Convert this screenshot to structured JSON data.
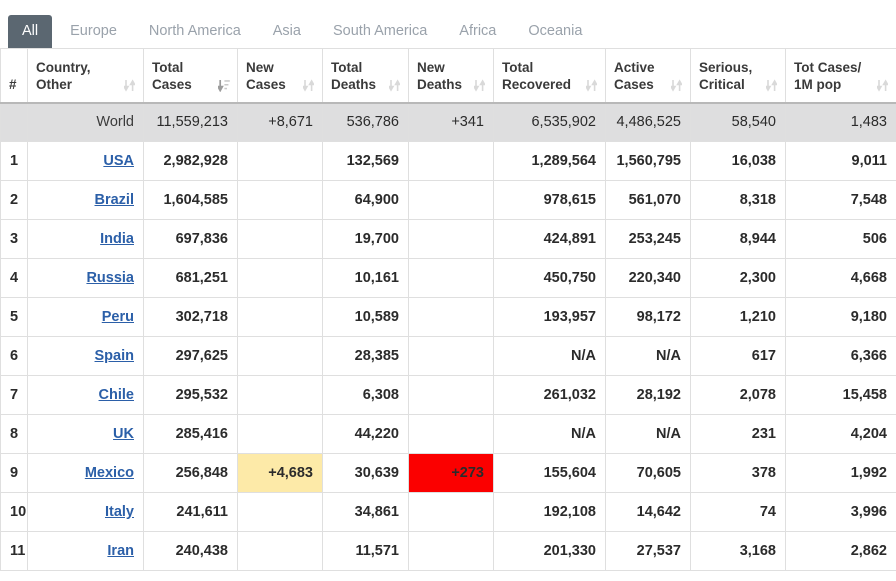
{
  "tabs": [
    {
      "label": "All",
      "active": true
    },
    {
      "label": "Europe",
      "active": false
    },
    {
      "label": "North America",
      "active": false
    },
    {
      "label": "Asia",
      "active": false
    },
    {
      "label": "South America",
      "active": false
    },
    {
      "label": "Africa",
      "active": false
    },
    {
      "label": "Oceania",
      "active": false
    }
  ],
  "colors": {
    "active_tab_bg": "#5b6771",
    "link": "#2b5fa8",
    "world_row_bg": "#dededf",
    "highlight_yellow": "#fdeaa8",
    "highlight_red": "#fb0000"
  },
  "table": {
    "columns": [
      {
        "id": "num",
        "line1": "#",
        "line2": "",
        "sort": "none"
      },
      {
        "id": "country",
        "line1": "Country,",
        "line2": "Other",
        "sort": "both"
      },
      {
        "id": "total_cases",
        "line1": "Total",
        "line2": "Cases",
        "sort": "desc"
      },
      {
        "id": "new_cases",
        "line1": "New",
        "line2": "Cases",
        "sort": "both"
      },
      {
        "id": "total_deaths",
        "line1": "Total",
        "line2": "Deaths",
        "sort": "both"
      },
      {
        "id": "new_deaths",
        "line1": "New",
        "line2": "Deaths",
        "sort": "both"
      },
      {
        "id": "total_recovered",
        "line1": "Total",
        "line2": "Recovered",
        "sort": "both"
      },
      {
        "id": "active_cases",
        "line1": "Active",
        "line2": "Cases",
        "sort": "both"
      },
      {
        "id": "serious_critical",
        "line1": "Serious,",
        "line2": "Critical",
        "sort": "both"
      },
      {
        "id": "tot_cases_1m",
        "line1": "Tot Cases/",
        "line2": "1M pop",
        "sort": "both"
      }
    ],
    "world_row": {
      "num": "",
      "country": "World",
      "total_cases": "11,559,213",
      "new_cases": "+8,671",
      "total_deaths": "536,786",
      "new_deaths": "+341",
      "total_recovered": "6,535,902",
      "active_cases": "4,486,525",
      "serious_critical": "58,540",
      "tot_cases_1m": "1,483"
    },
    "rows": [
      {
        "num": "1",
        "country": "USA",
        "total_cases": "2,982,928",
        "new_cases": "",
        "total_deaths": "132,569",
        "new_deaths": "",
        "total_recovered": "1,289,564",
        "active_cases": "1,560,795",
        "serious_critical": "16,038",
        "tot_cases_1m": "9,011",
        "new_cases_hl": "",
        "new_deaths_hl": ""
      },
      {
        "num": "2",
        "country": "Brazil",
        "total_cases": "1,604,585",
        "new_cases": "",
        "total_deaths": "64,900",
        "new_deaths": "",
        "total_recovered": "978,615",
        "active_cases": "561,070",
        "serious_critical": "8,318",
        "tot_cases_1m": "7,548",
        "new_cases_hl": "",
        "new_deaths_hl": ""
      },
      {
        "num": "3",
        "country": "India",
        "total_cases": "697,836",
        "new_cases": "",
        "total_deaths": "19,700",
        "new_deaths": "",
        "total_recovered": "424,891",
        "active_cases": "253,245",
        "serious_critical": "8,944",
        "tot_cases_1m": "506",
        "new_cases_hl": "",
        "new_deaths_hl": ""
      },
      {
        "num": "4",
        "country": "Russia",
        "total_cases": "681,251",
        "new_cases": "",
        "total_deaths": "10,161",
        "new_deaths": "",
        "total_recovered": "450,750",
        "active_cases": "220,340",
        "serious_critical": "2,300",
        "tot_cases_1m": "4,668",
        "new_cases_hl": "",
        "new_deaths_hl": ""
      },
      {
        "num": "5",
        "country": "Peru",
        "total_cases": "302,718",
        "new_cases": "",
        "total_deaths": "10,589",
        "new_deaths": "",
        "total_recovered": "193,957",
        "active_cases": "98,172",
        "serious_critical": "1,210",
        "tot_cases_1m": "9,180",
        "new_cases_hl": "",
        "new_deaths_hl": ""
      },
      {
        "num": "6",
        "country": "Spain",
        "total_cases": "297,625",
        "new_cases": "",
        "total_deaths": "28,385",
        "new_deaths": "",
        "total_recovered": "N/A",
        "active_cases": "N/A",
        "serious_critical": "617",
        "tot_cases_1m": "6,366",
        "new_cases_hl": "",
        "new_deaths_hl": ""
      },
      {
        "num": "7",
        "country": "Chile",
        "total_cases": "295,532",
        "new_cases": "",
        "total_deaths": "6,308",
        "new_deaths": "",
        "total_recovered": "261,032",
        "active_cases": "28,192",
        "serious_critical": "2,078",
        "tot_cases_1m": "15,458",
        "new_cases_hl": "",
        "new_deaths_hl": ""
      },
      {
        "num": "8",
        "country": "UK",
        "total_cases": "285,416",
        "new_cases": "",
        "total_deaths": "44,220",
        "new_deaths": "",
        "total_recovered": "N/A",
        "active_cases": "N/A",
        "serious_critical": "231",
        "tot_cases_1m": "4,204",
        "new_cases_hl": "",
        "new_deaths_hl": ""
      },
      {
        "num": "9",
        "country": "Mexico",
        "total_cases": "256,848",
        "new_cases": "+4,683",
        "total_deaths": "30,639",
        "new_deaths": "+273",
        "total_recovered": "155,604",
        "active_cases": "70,605",
        "serious_critical": "378",
        "tot_cases_1m": "1,992",
        "new_cases_hl": "yellow",
        "new_deaths_hl": "red"
      },
      {
        "num": "10",
        "country": "Italy",
        "total_cases": "241,611",
        "new_cases": "",
        "total_deaths": "34,861",
        "new_deaths": "",
        "total_recovered": "192,108",
        "active_cases": "14,642",
        "serious_critical": "74",
        "tot_cases_1m": "3,996",
        "new_cases_hl": "",
        "new_deaths_hl": ""
      },
      {
        "num": "11",
        "country": "Iran",
        "total_cases": "240,438",
        "new_cases": "",
        "total_deaths": "11,571",
        "new_deaths": "",
        "total_recovered": "201,330",
        "active_cases": "27,537",
        "serious_critical": "3,168",
        "tot_cases_1m": "2,862",
        "new_cases_hl": "",
        "new_deaths_hl": ""
      }
    ]
  }
}
